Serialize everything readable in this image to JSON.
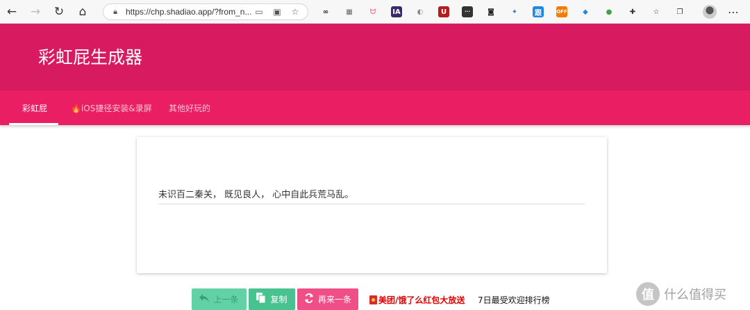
{
  "browser": {
    "url": "https://chp.shadiao.app/?from_n..."
  },
  "extensions": [
    {
      "name": "infinity-ext-icon",
      "glyph": "∞",
      "bg": "transparent",
      "fg": "#222"
    },
    {
      "name": "tab-ext-icon",
      "glyph": "▦",
      "bg": "transparent",
      "fg": "#666"
    },
    {
      "name": "cat-ext-icon",
      "glyph": "ᗢ",
      "bg": "transparent",
      "fg": "#ff7aa2"
    },
    {
      "name": "ia-ext-icon",
      "glyph": "IA",
      "bg": "#3b2a6b",
      "fg": "#fff"
    },
    {
      "name": "mouse-ext-icon",
      "glyph": "◐",
      "bg": "transparent",
      "fg": "#888"
    },
    {
      "name": "shield-ext-icon",
      "glyph": "U",
      "bg": "#b71c1c",
      "fg": "#fff"
    },
    {
      "name": "terminal-ext-icon",
      "glyph": "···",
      "bg": "#333",
      "fg": "#fff"
    },
    {
      "name": "screenshot-ext-icon",
      "glyph": "◙",
      "bg": "transparent",
      "fg": "#222"
    },
    {
      "name": "bird-ext-icon",
      "glyph": "✦",
      "bg": "transparent",
      "fg": "#3a7bd5"
    },
    {
      "name": "translate-ext-icon",
      "glyph": "跟",
      "bg": "#1e88e5",
      "fg": "#fff"
    },
    {
      "name": "off-ext-icon",
      "glyph": "OFF",
      "bg": "#f57c00",
      "fg": "#fff"
    },
    {
      "name": "shield-color-ext-icon",
      "glyph": "◆",
      "bg": "transparent",
      "fg": "#1e88e5"
    },
    {
      "name": "palette-ext-icon",
      "glyph": "●",
      "bg": "transparent",
      "fg": "#43a047"
    },
    {
      "name": "puzzle-ext-icon",
      "glyph": "✚",
      "bg": "transparent",
      "fg": "#333"
    },
    {
      "name": "favorites-ext-icon",
      "glyph": "☆",
      "bg": "transparent",
      "fg": "#333"
    },
    {
      "name": "collections-ext-icon",
      "glyph": "❐",
      "bg": "transparent",
      "fg": "#333"
    }
  ],
  "header": {
    "title": "彩虹屁生成器"
  },
  "tabs": [
    {
      "label": "彩虹屁"
    },
    {
      "label": "🔥iOS捷径安装&录屏"
    },
    {
      "label": "其他好玩的"
    }
  ],
  "card": {
    "compliment": "未识百二秦关， 既见良人， 心中自此兵荒马乱。"
  },
  "buttons": {
    "prev": "上一条",
    "copy": "复制",
    "next": "再来一条"
  },
  "links": {
    "promo": "美团/饿了么红包大放送",
    "rank": "7日最受欢迎排行榜"
  },
  "watermark": {
    "logo": "值",
    "text": "什么值得买"
  },
  "colors": {
    "header": "#d81b60",
    "tabs": "#e91e63",
    "copy": "#48c28e",
    "next": "#ef4f86"
  }
}
